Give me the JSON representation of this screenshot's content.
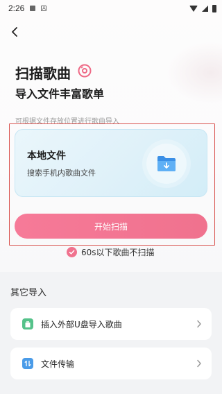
{
  "status": {
    "time": "2:26"
  },
  "header": {
    "title": "扫描歌曲",
    "subtitle": "导入文件丰富歌单"
  },
  "hint": "可根据文件存放位置进行歌曲导入",
  "local_card": {
    "title": "本地文件",
    "subtitle": "搜索手机内歌曲文件"
  },
  "scan_button": "开始扫描",
  "skip_option": {
    "label": "60s以下歌曲不扫描",
    "checked": true
  },
  "other_import": {
    "title": "其它导入",
    "items": [
      {
        "label": "插入外部U盘导入歌曲",
        "icon": "usb-icon"
      },
      {
        "label": "文件传输",
        "icon": "transfer-icon"
      }
    ]
  },
  "colors": {
    "accent": "#f0728e",
    "card": "#dff1f9",
    "usb": "#55c28a",
    "transfer": "#4a9be8",
    "highlight": "#d9534f"
  }
}
